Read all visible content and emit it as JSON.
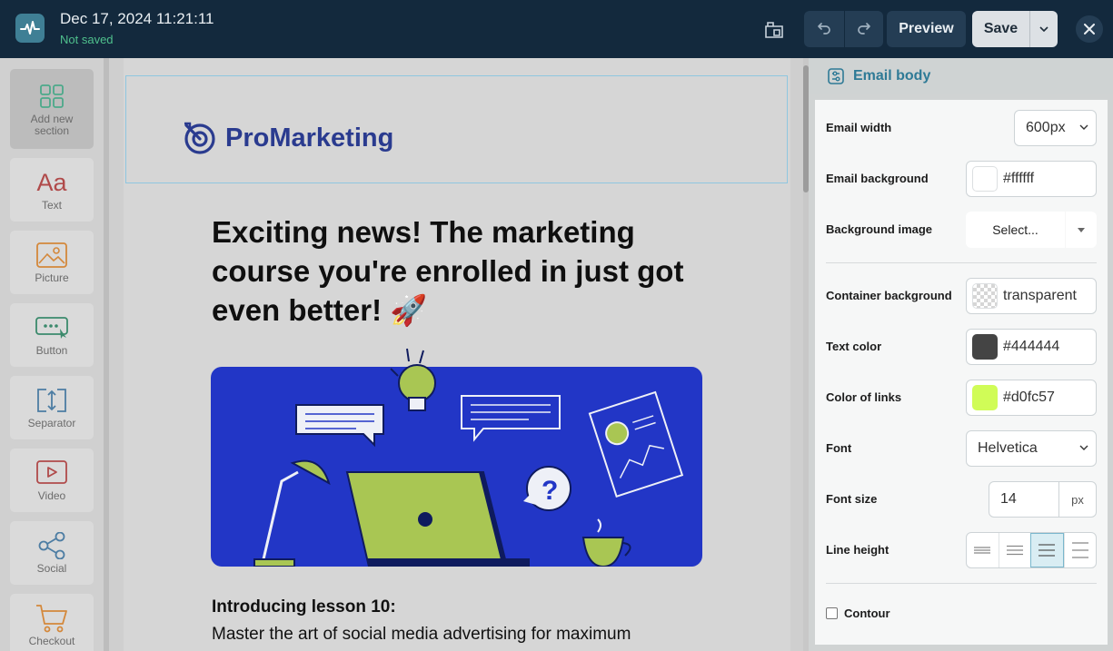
{
  "header": {
    "timestamp": "Dec 17, 2024 11:21:11",
    "save_status": "Not saved",
    "preview_label": "Preview",
    "save_label": "Save",
    "status_color": "#4fc08d"
  },
  "sidebar": {
    "items": [
      {
        "label": "Add new section",
        "icon": "grid-icon"
      },
      {
        "label": "Text",
        "icon": "text-aa-icon"
      },
      {
        "label": "Picture",
        "icon": "picture-icon"
      },
      {
        "label": "Button",
        "icon": "button-icon"
      },
      {
        "label": "Separator",
        "icon": "separator-icon"
      },
      {
        "label": "Video",
        "icon": "video-icon"
      },
      {
        "label": "Social",
        "icon": "share-icon"
      },
      {
        "label": "Checkout",
        "icon": "cart-icon"
      }
    ]
  },
  "email": {
    "brand": "ProMarketing",
    "headline": "Exciting news! The marketing course you're enrolled in just got even better! 🚀",
    "intro_title": "Introducing lesson 10:",
    "intro_text": "Master the art of social media advertising for maximum"
  },
  "panel": {
    "title": "Email body",
    "email_width_label": "Email width",
    "email_width_value": "600px",
    "email_background_label": "Email background",
    "email_background_value": "#ffffff",
    "background_image_label": "Background image",
    "background_image_value": "Select...",
    "container_background_label": "Container background",
    "container_background_value": "transparent",
    "text_color_label": "Text color",
    "text_color_value": "#444444",
    "link_color_label": "Color of links",
    "link_color_value": "#d0fc57",
    "font_label": "Font",
    "font_value": "Helvetica",
    "font_size_label": "Font size",
    "font_size_value": "14",
    "font_size_unit": "px",
    "line_height_label": "Line height",
    "line_height_selected": 3,
    "contour_label": "Contour"
  }
}
